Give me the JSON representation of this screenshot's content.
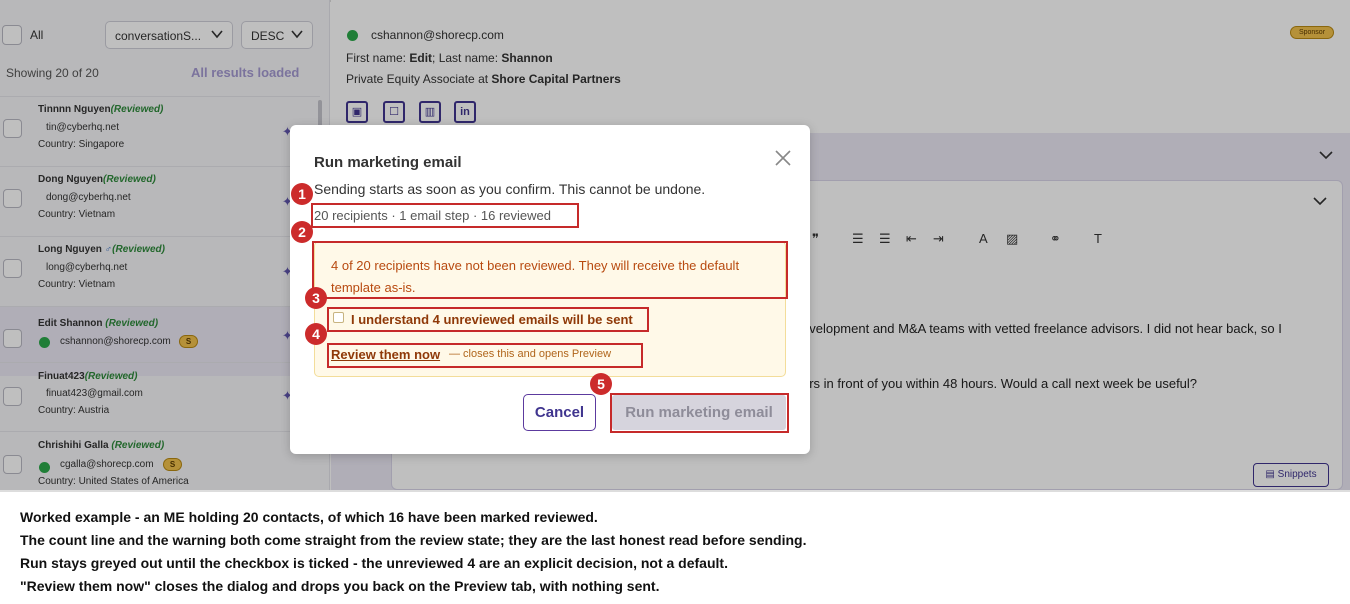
{
  "left_panel": {
    "all_label": "All",
    "sort_field": "conversationS...",
    "sort_order": "DESC",
    "showing": "Showing 20 of 20",
    "loaded": "All results loaded",
    "contacts": [
      {
        "name": "Tinnnn Nguyen",
        "status": "(Reviewed)",
        "email": "tin@cyberhq.net",
        "country": "Country: Singapore"
      },
      {
        "name": "Dong Nguyen",
        "status": "(Reviewed)",
        "email": "dong@cyberhq.net",
        "country": "Country: Vietnam"
      },
      {
        "name": "Long Nguyen",
        "gender": "♂",
        "status": "(Reviewed)",
        "email": "long@cyberhq.net",
        "country": "Country: Vietnam"
      },
      {
        "name": "Edit Shannon",
        "status": "(Reviewed)",
        "email": "cshannon@shorecp.com",
        "badge": "S"
      },
      {
        "name": "Finuat423",
        "status": "(Reviewed)",
        "email": "finuat423@gmail.com",
        "country": "Country: Austria"
      },
      {
        "name": "Chrishihi Galla",
        "status": "(Reviewed)",
        "email": "cgalla@shorecp.com",
        "badge": "S",
        "country": "Country: United States of America"
      }
    ]
  },
  "contact_detail": {
    "email": "cshannon@shorecp.com",
    "sponsor_badge": "Sponsor",
    "first_name_label": "First name: ",
    "first_name": "Edit",
    "last_name_label": "; Last name: ",
    "last_name": "Shannon",
    "role_prefix": "Private Equity Associate at ",
    "company": "Shore Capital Partners",
    "body_line_1": "evelopment and M&A teams with vetted freelance advisors. I did not hear back, so I",
    "body_line_2": "ors in front of you within 48 hours. Would a call next week be useful?",
    "snippets_label": "Snippets",
    "icons": [
      "portrait-icon",
      "contact-card-icon",
      "building-icon",
      "linkedin-icon"
    ]
  },
  "modal": {
    "title": "Run marketing email",
    "subtitle": "Sending starts as soon as you confirm. This cannot be undone.",
    "count_line": "20 recipients · 1 email step · 16 reviewed",
    "warning": "4 of 20 recipients have not been reviewed. They will receive the default template as-is.",
    "ack_label": "I understand 4 unreviewed emails will be sent",
    "review_link": "Review them now",
    "review_note": "— closes this and opens Preview",
    "cancel_label": "Cancel",
    "run_label": "Run marketing email"
  },
  "annotations": [
    "1",
    "2",
    "3",
    "4",
    "5"
  ],
  "caption": {
    "line1": "Worked example - an ME holding 20 contacts, of which 16 have been marked reviewed.",
    "line2": "The count line and the warning both come straight from the review state; they are the last honest read before sending.",
    "line3": "Run stays greyed out until the checkbox is ticked - the unreviewed 4 are an explicit decision, not a default.",
    "line4": "\"Review them now\" closes the dialog and drops you back on the Preview tab, with nothing sent."
  },
  "colors": {
    "accent": "#40358f",
    "reviewed": "#2e8a3b",
    "warning_text": "#b84a10",
    "annotation": "#c62a2a"
  }
}
